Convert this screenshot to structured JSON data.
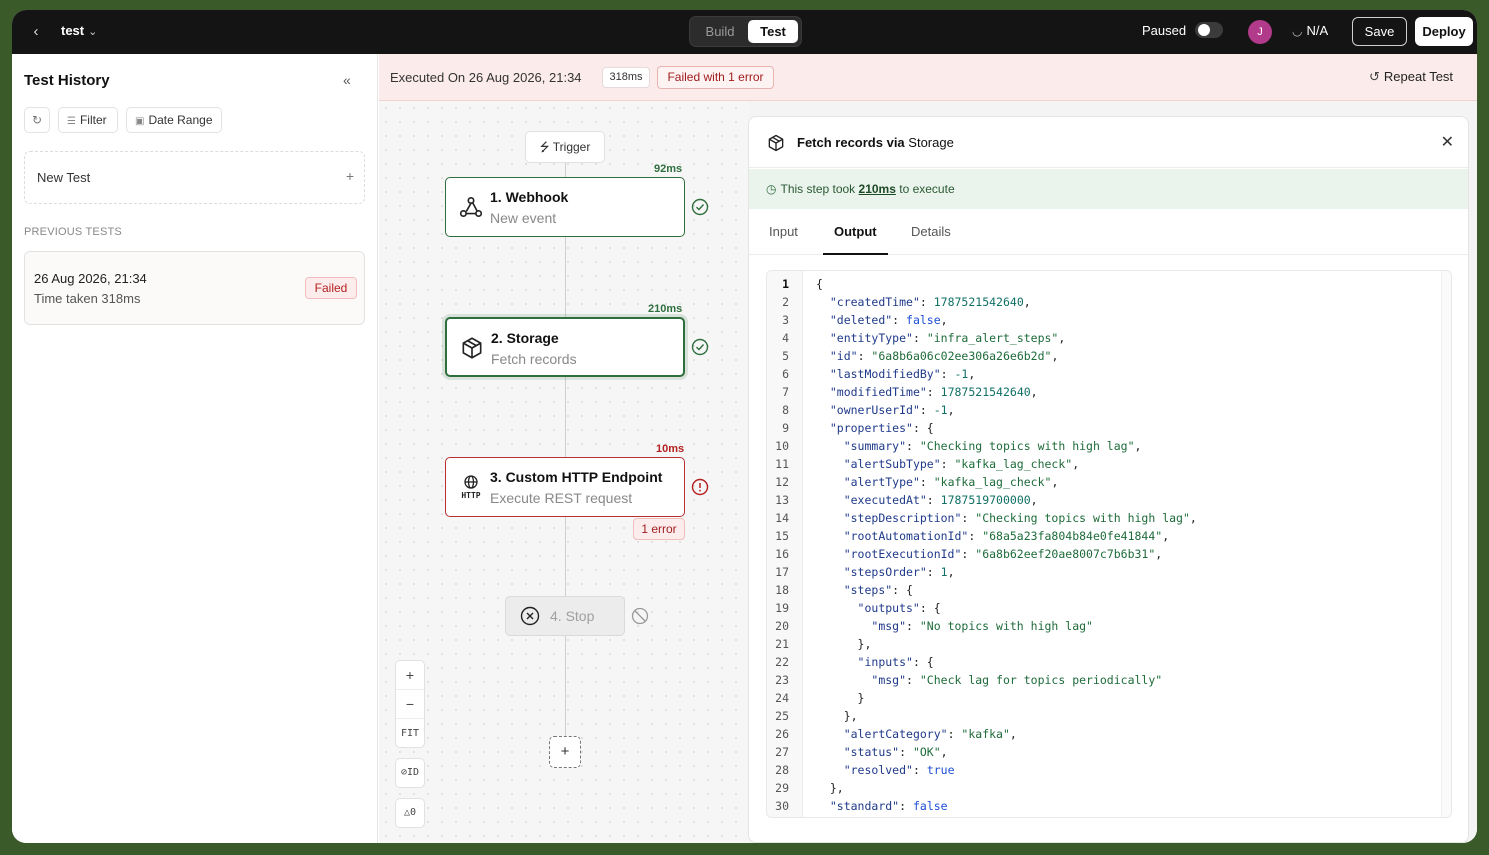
{
  "topbar": {
    "project": "test",
    "build_label": "Build",
    "test_label": "Test",
    "paused_label": "Paused",
    "avatar_initial": "J",
    "na_label": "N/A",
    "save_label": "Save",
    "deploy_label": "Deploy"
  },
  "sidebar": {
    "title": "Test History",
    "filter_label": "Filter",
    "date_range_label": "Date Range",
    "new_test_label": "New Test",
    "previous_tests_label": "PREVIOUS TESTS",
    "tests": [
      {
        "date": "26 Aug 2026, 21:34",
        "time_taken": "Time taken 318ms",
        "status": "Failed"
      }
    ]
  },
  "banner": {
    "executed": "Executed On 26 Aug 2026, 21:34",
    "duration": "318ms",
    "error_summary": "Failed with 1 error",
    "repeat_label": "Repeat Test"
  },
  "canvas": {
    "trigger_label": "Trigger",
    "nodes": [
      {
        "title": "1. Webhook",
        "subtitle": "New event",
        "time": "92ms",
        "status": "success"
      },
      {
        "title": "2. Storage",
        "subtitle": "Fetch records",
        "time": "210ms",
        "status": "success"
      },
      {
        "title": "3. Custom HTTP Endpoint",
        "subtitle": "Execute REST request",
        "time": "10ms",
        "status": "error"
      }
    ],
    "error_tag": "1 error",
    "stop_label": "4. Stop",
    "zoom_in": "+",
    "zoom_out": "−",
    "fit_label": "FIT",
    "id_label": "ID",
    "warn_count": "0"
  },
  "panel": {
    "title_prefix": "Fetch records via ",
    "title_app": "Storage",
    "took_prefix": "This step took ",
    "took_value": "210ms",
    "took_suffix": " to execute",
    "tabs": [
      "Input",
      "Output",
      "Details"
    ],
    "active_tab": "Output"
  },
  "colors": {
    "success": "#2f6e3d",
    "error": "#b42020",
    "topbar": "#141414"
  }
}
